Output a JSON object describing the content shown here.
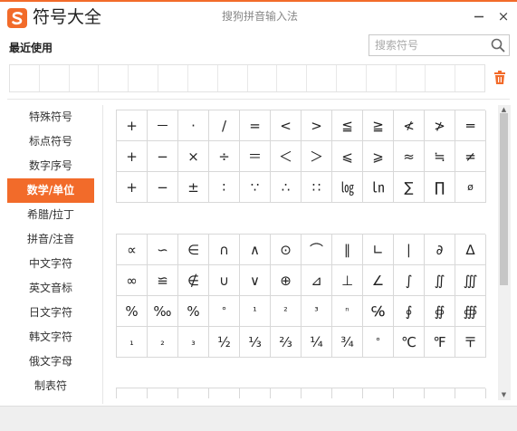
{
  "app": {
    "title": "符号大全",
    "ime_name": "搜狗拼音输入法",
    "close_label": "×",
    "brand_color": "#f26b2a"
  },
  "recent": {
    "label": "最近使用",
    "slots": 16
  },
  "search": {
    "placeholder": "搜索符号",
    "value": ""
  },
  "sidebar": {
    "items": [
      {
        "label": "特殊符号"
      },
      {
        "label": "标点符号"
      },
      {
        "label": "数字序号"
      },
      {
        "label": "数学/单位",
        "active": true
      },
      {
        "label": "希腊/拉丁"
      },
      {
        "label": "拼音/注音"
      },
      {
        "label": "中文字符"
      },
      {
        "label": "英文音标"
      },
      {
        "label": "日文字符"
      },
      {
        "label": "韩文字符"
      },
      {
        "label": "俄文字母"
      },
      {
        "label": "制表符"
      }
    ]
  },
  "symbol_blocks": [
    [
      "+",
      "－",
      "·",
      "/",
      "=",
      "<",
      ">",
      "≦",
      "≧",
      "≮",
      "≯",
      "═",
      "+",
      "−",
      "×",
      "÷",
      "＝",
      "＜",
      "＞",
      "⩽",
      "⩾",
      "≈",
      "≒",
      "≠",
      "+",
      "−",
      "±",
      "∶",
      "∵",
      "∴",
      "∷",
      "㏒",
      "㏑",
      "∑",
      "∏",
      "ø"
    ],
    [
      "∝",
      "∽",
      "∈",
      "∩",
      "∧",
      "⊙",
      "⌒",
      "∥",
      "∟",
      "∣",
      "∂",
      "∆",
      "∞",
      "≌",
      "∉",
      "∪",
      "∨",
      "⊕",
      "⊿",
      "⊥",
      "∠",
      "∫",
      "∬",
      "∭",
      "%",
      "‰",
      "%",
      "°",
      "¹",
      "²",
      "³",
      "ⁿ",
      "℅",
      "∮",
      "∯",
      "∰",
      "₁",
      "₂",
      "₃",
      "½",
      "⅓",
      "⅔",
      "¼",
      "¾",
      "°",
      "℃",
      "℉",
      "〒"
    ]
  ],
  "small_symbols": [
    "¹",
    "²",
    "³",
    "ⁿ",
    "₁",
    "₂",
    "₃",
    "°",
    "ø"
  ]
}
